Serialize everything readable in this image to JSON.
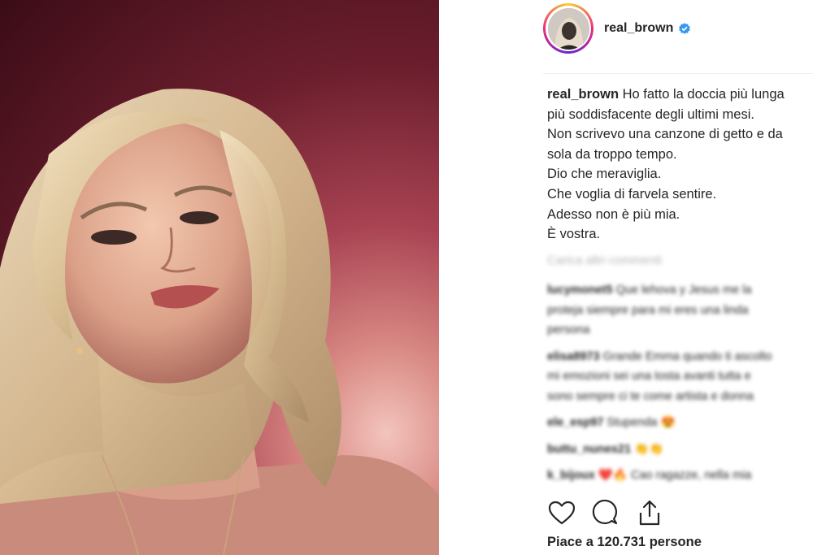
{
  "post": {
    "username": "real_brown",
    "verified": true,
    "caption_user": "real_brown",
    "caption_lines": [
      "Ho fatto la doccia più lunga",
      "più soddisfacente degli ultimi mesi.",
      "Non scrivevo una canzone di getto e da",
      "sola da troppo tempo.",
      "Dio che meraviglia.",
      "Che voglia di farvela sentire.",
      "Adesso non è più mia.",
      "È vostra."
    ],
    "load_more": "Carica altri commenti",
    "comments": [
      {
        "user": "lucymonet5",
        "lines": [
          "Que lehova y Jesus me la",
          "proteja siempre para mi eres una linda",
          "persona"
        ]
      },
      {
        "user": "elisa8973",
        "lines": [
          "Grande Emma quando ti ascolto",
          "mi emozioni sei una tosta avanti tutta e",
          "sono sempre ci te come artista e donna"
        ]
      },
      {
        "user": "ele_esp97",
        "lines": [
          "Stupenda 😍"
        ]
      },
      {
        "user": "buttu_nunes21",
        "lines": [
          "👏👏"
        ]
      },
      {
        "user": "k_bijoux",
        "lines": [
          "❤️🔥 Cao ragazze, nella mia"
        ]
      }
    ],
    "likes_text": "Piace a 120.731 persone"
  },
  "icons": {
    "like": "heart-icon",
    "comment": "comment-icon",
    "share": "share-icon",
    "verified": "verified-badge-icon"
  },
  "colors": {
    "verified_blue": "#3897f0",
    "text": "#262626"
  }
}
